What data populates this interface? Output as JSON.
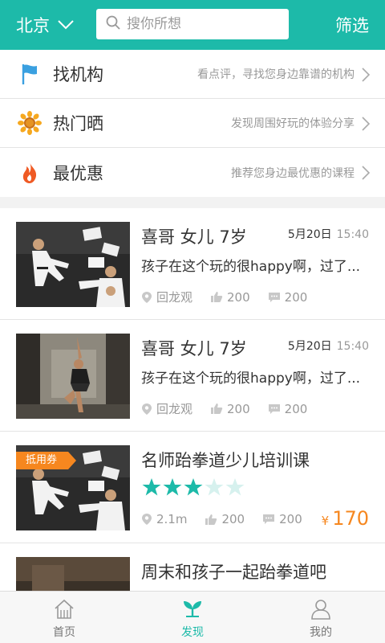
{
  "header": {
    "city": "北京",
    "search_placeholder": "搜你所想",
    "filter_label": "筛选"
  },
  "menu": [
    {
      "title": "找机构",
      "desc": "看点评，寻找您身边靠谱的机构",
      "icon": "flag-icon"
    },
    {
      "title": "热门晒",
      "desc": "发现周围好玩的体验分享",
      "icon": "sunflower-icon"
    },
    {
      "title": "最优惠",
      "desc": "推荐您身边最优惠的课程",
      "icon": "flame-icon"
    }
  ],
  "feed": [
    {
      "title": "喜哥  女儿 7岁",
      "date": "5月20日",
      "time": "15:40",
      "body": "孩子在这个玩的很happy啊，过了...",
      "location": "回龙观",
      "likes": "200",
      "comments": "200",
      "image": "taekwondo-photo"
    },
    {
      "title": "喜哥  女儿 7岁",
      "date": "5月20日",
      "time": "15:40",
      "body": "孩子在这个玩的很happy啊，过了...",
      "location": "回龙观",
      "likes": "200",
      "comments": "200",
      "image": "dancer-photo"
    },
    {
      "title": "名师跆拳道少儿培训课",
      "badge": "抵用券",
      "rating": 3,
      "rating_max": 5,
      "distance": "2.1m",
      "likes": "200",
      "comments": "200",
      "currency": "¥",
      "price": "170",
      "image": "taekwondo-photo"
    },
    {
      "title": "周末和孩子一起跆拳道吧",
      "image": "taekwondo-photo"
    }
  ],
  "tabs": [
    {
      "label": "首页",
      "icon": "home-icon",
      "active": false
    },
    {
      "label": "发现",
      "icon": "sprout-icon",
      "active": true
    },
    {
      "label": "我的",
      "icon": "user-icon",
      "active": false
    }
  ],
  "colors": {
    "accent": "#1dbaa9",
    "orange": "#f6871f",
    "star_off": "#d6f1ee"
  }
}
